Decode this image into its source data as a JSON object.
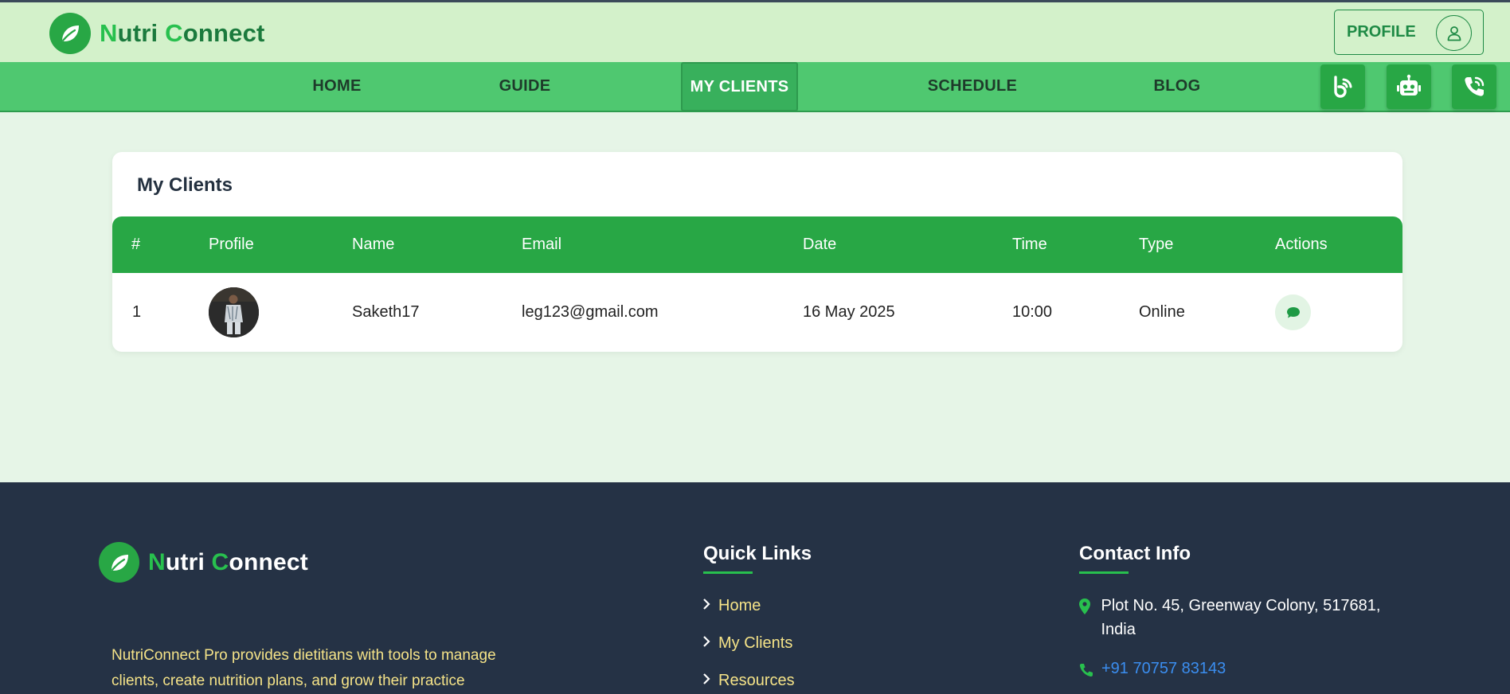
{
  "header": {
    "brand": {
      "first_cap": "N",
      "first_rest": "utri ",
      "second_cap": "C",
      "second_rest": "onnect"
    },
    "profile_label": "PROFILE"
  },
  "nav": {
    "items": [
      {
        "label": "HOME"
      },
      {
        "label": "GUIDE"
      },
      {
        "label": "MY CLIENTS",
        "active": true
      },
      {
        "label": "SCHEDULE"
      },
      {
        "label": "BLOG"
      }
    ],
    "icons": [
      "blog-icon",
      "robot-icon",
      "phone-icon"
    ]
  },
  "clients": {
    "title": "My Clients",
    "columns": [
      "#",
      "Profile",
      "Name",
      "Email",
      "Date",
      "Time",
      "Type",
      "Actions"
    ],
    "rows": [
      {
        "index": "1",
        "name": "Saketh17",
        "email": "leg123@gmail.com",
        "date": "16 May 2025",
        "time": "10:00",
        "type": "Online"
      }
    ]
  },
  "footer": {
    "brand": {
      "first_cap": "N",
      "first_rest": "utri ",
      "second_cap": "C",
      "second_rest": "onnect"
    },
    "description": "NutriConnect Pro provides dietitians with tools to manage clients, create nutrition plans, and grow their practice",
    "quick_links_title": "Quick Links",
    "quick_links": [
      "Home",
      "My Clients",
      "Resources"
    ],
    "contact_title": "Contact Info",
    "address": "Plot No. 45, Greenway Colony, 517681, India",
    "phone": "+91 70757 83143"
  },
  "colors": {
    "primary": "#28a745",
    "nav": "#4fc870",
    "header_bg": "#d3f1ca",
    "page_bg": "#e6f5e7",
    "footer_bg": "#253245",
    "footer_text": "#f5e388",
    "phone_link": "#3b8ef0"
  }
}
